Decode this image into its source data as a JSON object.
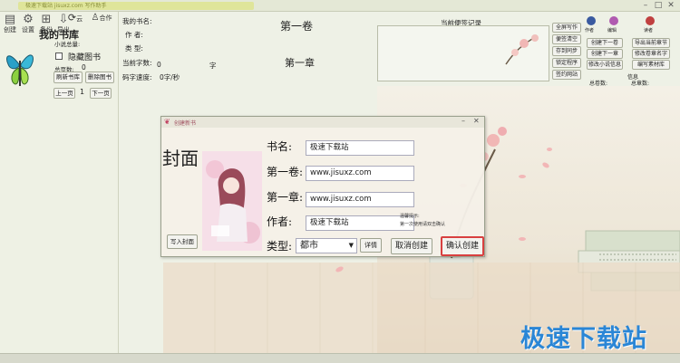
{
  "window": {
    "title": "极速下载站 jisuxz.com 写作助手"
  },
  "toolbar": {
    "items": [
      {
        "label": "创建",
        "icon": "new-book-icon"
      },
      {
        "label": "设置",
        "icon": "gear-icon"
      },
      {
        "label": "备份",
        "icon": "backup-icon"
      },
      {
        "label": "导出",
        "icon": "export-icon"
      },
      {
        "label": "云",
        "icon": "cloud-icon"
      },
      {
        "label": "合作",
        "icon": "cooperate-icon"
      }
    ]
  },
  "library": {
    "title": "我的书库",
    "novel_count_label": "小说总量:",
    "hide_label": "隐藏图书",
    "pages_label": "总页数:",
    "pages_value": "0",
    "refresh_label": "刷新书库",
    "delete_label": "删除图书",
    "prev_label": "上一页",
    "page_value": "1",
    "next_label": "下一页"
  },
  "book_info": {
    "name_label": "我的书名:",
    "author_label": "作 者:",
    "type_label": "类 型:",
    "current_words_label": "当前字数:",
    "current_words_value": "0",
    "char_unit": "字",
    "speed_label": "码字速度:",
    "speed_value": "0字/秒",
    "volume": "第一卷",
    "chapter": "第一章"
  },
  "notes": {
    "title": "当前便签记录",
    "buttons": [
      "全屏写作",
      "便签清空",
      "存到同步",
      "锁定程序",
      "签约网站"
    ]
  },
  "right_panel": {
    "avatars": [
      {
        "label": "作者",
        "color": "#3a5aa0"
      },
      {
        "label": "编辑",
        "color": "#b05ab0"
      },
      {
        "label": "读者",
        "color": "#c04040"
      }
    ],
    "buttons": [
      "创建下一卷",
      "导出当前章节",
      "创建下一章",
      "修改卷章名字",
      "修改小说信息",
      "编写素材库"
    ],
    "info_title": "信息",
    "total_volumes_label": "总卷数:",
    "total_chapters_label": "总章数:"
  },
  "dialog": {
    "title": "创建新书",
    "cover_label": "封面",
    "write_cover_button": "写入封面",
    "name_label": "书名:",
    "name_value": "极速下载站",
    "volume_label": "第一卷:",
    "volume_value": "www.jisuxz.com",
    "chapter_label": "第一章:",
    "chapter_value": "www.jisuxz.com",
    "author_label": "作者:",
    "author_value": "极速下载站",
    "type_label": "类型:",
    "type_value": "都市",
    "detail_button": "详情",
    "tip_line1": "温馨提示:",
    "tip_line2": "第一次使用请双击确认",
    "cancel_button": "取消创建",
    "confirm_button": "确认创建"
  },
  "watermark": "极速下载站"
}
